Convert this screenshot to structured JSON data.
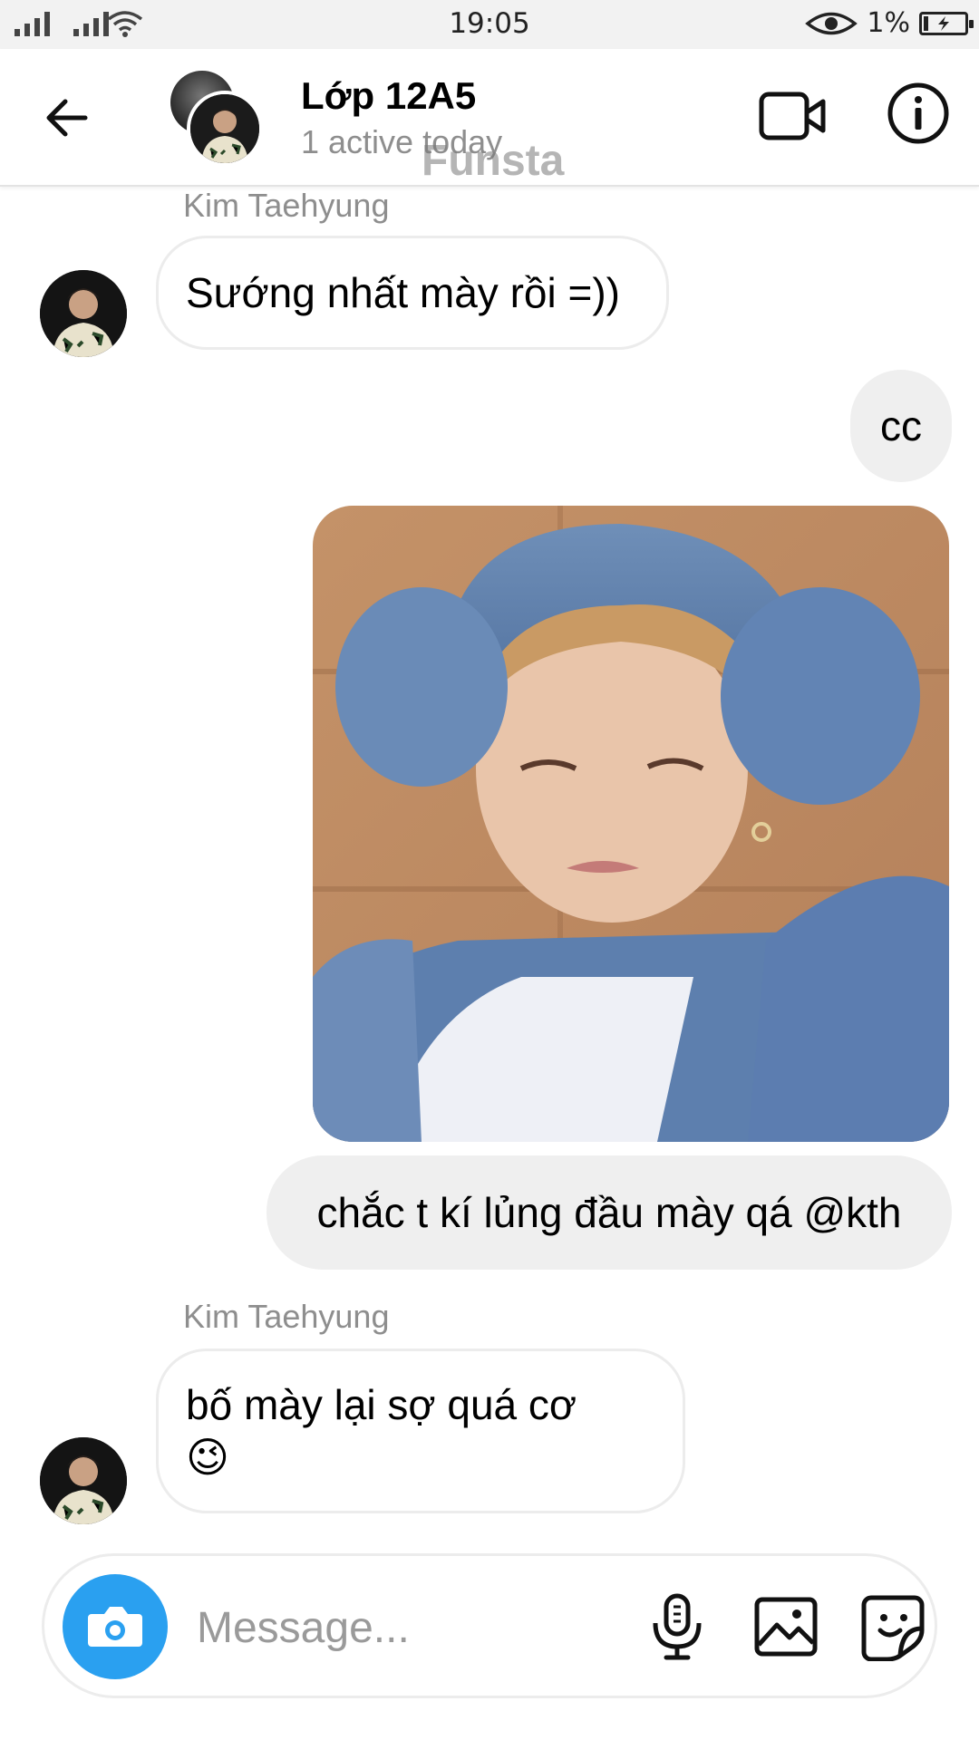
{
  "status_bar": {
    "time": "19:05",
    "battery": "1%",
    "icons": [
      "signal-icon",
      "signal-icon",
      "wifi-icon",
      "eye-icon",
      "battery-charging-icon"
    ]
  },
  "header": {
    "title": "Lớp 12A5",
    "subtitle": "1 active today",
    "watermark": "Funsta",
    "icons": [
      "back-arrow-icon",
      "video-call-icon",
      "info-icon"
    ]
  },
  "messages": [
    {
      "direction": "incoming",
      "sender": "Kim Taehyung",
      "text": "Sướng nhất mày rồi =))"
    },
    {
      "direction": "outgoing",
      "text": "cc"
    },
    {
      "direction": "outgoing",
      "type": "photo",
      "description": "sticker photo"
    },
    {
      "direction": "outgoing",
      "text": "chắc t kí lủng đầu mày qá @kth"
    },
    {
      "direction": "incoming",
      "sender": "Kim Taehyung",
      "text": "bố mày lại sợ quá cơ",
      "emoji": "😉"
    }
  ],
  "composer": {
    "placeholder": "Message...",
    "icons": [
      "camera-icon",
      "microphone-icon",
      "gallery-icon",
      "sticker-icon"
    ]
  },
  "colors": {
    "accent": "#2aa0f0",
    "outgoing_bubble": "#efefef",
    "incoming_border": "#ececec",
    "secondary_text": "#8e8e8e"
  }
}
